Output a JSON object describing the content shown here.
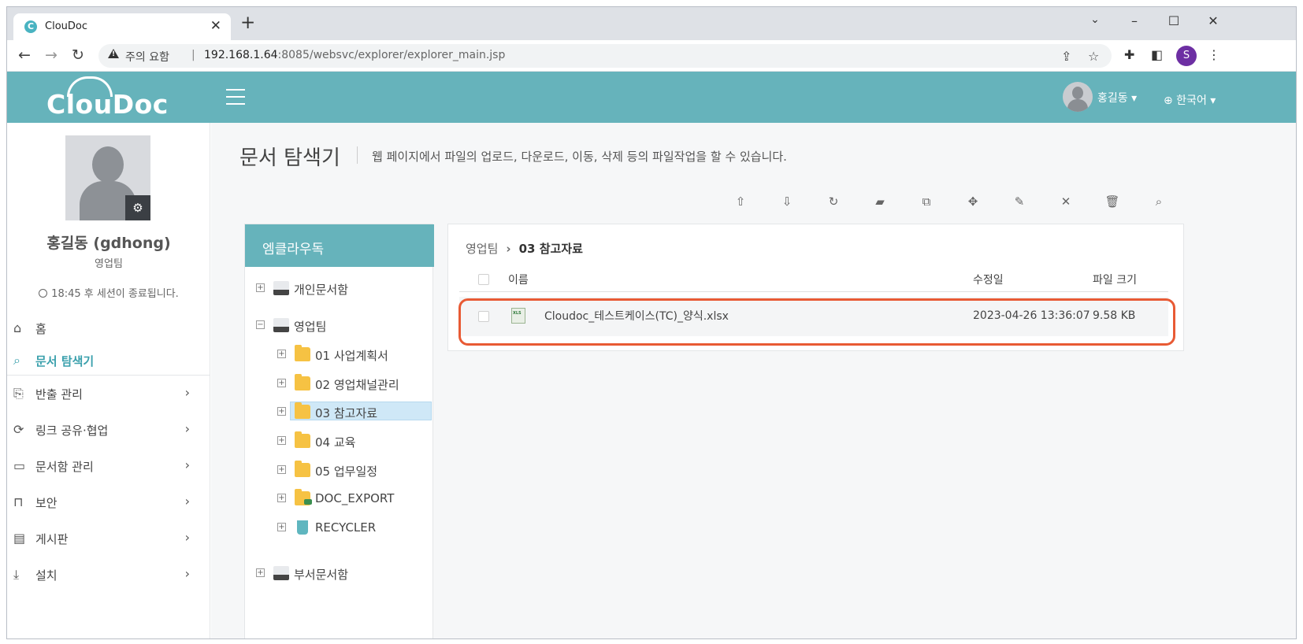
{
  "browser": {
    "tab_title": "ClouDoc",
    "tab_close": "✕",
    "new_tab": "+",
    "favicon_letter": "C",
    "warning_text": "주의 요함",
    "separator": "|",
    "url_host": "192.168.1.64",
    "url_rest": ":8085/websvc/explorer/explorer_main.jsp",
    "profile_letter": "S",
    "icons": [
      "back-icon",
      "forward-icon",
      "reload-icon",
      "share-icon",
      "star-icon",
      "extensions-icon",
      "sidepanel-icon",
      "menu-icon"
    ]
  },
  "header": {
    "logo_text": "ClouDoc",
    "user_name": "홍길동 ▾",
    "language": "⊕ 한국어 ▾",
    "accent_color": "#66b3bb"
  },
  "sidebar": {
    "profile_name": "홍길동 (gdhong)",
    "profile_dept": "영업팀",
    "session_text": "18:45 후 세션이 종료됩니다.",
    "items": [
      {
        "label": "홈",
        "icon": "home-icon",
        "chevron": false
      },
      {
        "label": "문서 탐색기",
        "icon": "explorer-icon",
        "chevron": false,
        "active": true
      },
      {
        "label": "반출 관리",
        "icon": "export-icon",
        "chevron": true
      },
      {
        "label": "링크 공유·협업",
        "icon": "link-share-icon",
        "chevron": true
      },
      {
        "label": "문서함 관리",
        "icon": "folder-settings-icon",
        "chevron": true
      },
      {
        "label": "보안",
        "icon": "lock-icon",
        "chevron": true
      },
      {
        "label": "게시판",
        "icon": "board-icon",
        "chevron": true
      },
      {
        "label": "설치",
        "icon": "download-icon",
        "chevron": true
      }
    ]
  },
  "main": {
    "title": "문서 탐색기",
    "description": "웹 페이지에서 파일의 업로드, 다운로드, 이동, 삭제 등의 파일작업을 할 수 있습니다.",
    "toolbar_icons": [
      "upload-icon",
      "download-icon",
      "refresh-icon",
      "new-folder-icon",
      "copy-icon",
      "move-icon",
      "rename-icon",
      "close-icon",
      "trash-icon",
      "search-icon"
    ]
  },
  "tree": {
    "header": "엠클라우독",
    "personal": "개인문서함",
    "team": "영업팀",
    "folders": [
      "01 사업계획서",
      "02 영업채널관리",
      "03 참고자료",
      "04 교육",
      "05 업무일정",
      "DOC_EXPORT",
      "RECYCLER"
    ],
    "selected": "03 참고자료",
    "dept": "부서문서함",
    "expand_plus": "+",
    "expand_minus": "−"
  },
  "files": {
    "breadcrumb_root": "영업팀",
    "breadcrumb_current": "03 참고자료",
    "columns": {
      "name": "이름",
      "modified": "수정일",
      "size": "파일 크기"
    },
    "rows": [
      {
        "name": "Cloudoc_테스트케이스(TC)_양식.xlsx",
        "modified": "2023-04-26 13:36:07",
        "size": "9.58 KB"
      }
    ],
    "highlight_color": "#e85a34"
  }
}
